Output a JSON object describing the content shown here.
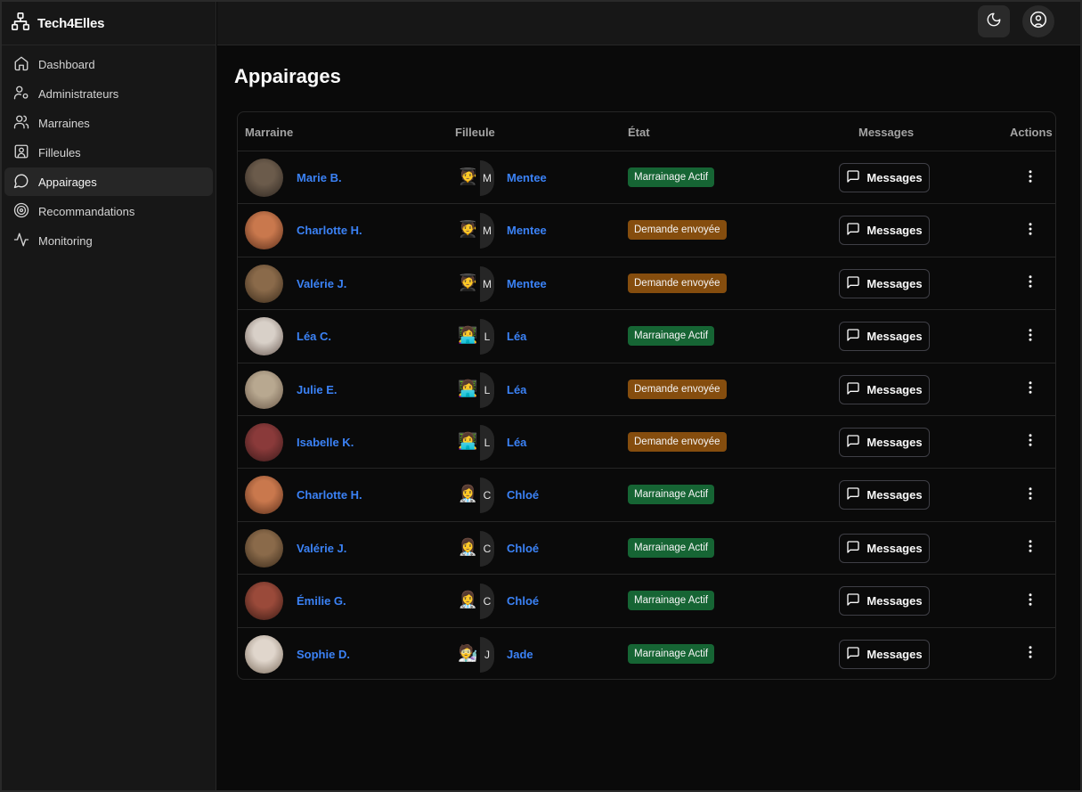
{
  "app": {
    "name": "Tech4Elles"
  },
  "sidebar": {
    "items": [
      {
        "label": "Dashboard",
        "icon": "home-icon"
      },
      {
        "label": "Administrateurs",
        "icon": "user-cog-icon"
      },
      {
        "label": "Marraines",
        "icon": "users-icon"
      },
      {
        "label": "Filleules",
        "icon": "contact-icon"
      },
      {
        "label": "Appairages",
        "icon": "message-circle-icon",
        "active": true
      },
      {
        "label": "Recommandations",
        "icon": "target-icon"
      },
      {
        "label": "Monitoring",
        "icon": "activity-icon"
      }
    ]
  },
  "page": {
    "title": "Appairages"
  },
  "table": {
    "headers": {
      "marraine": "Marraine",
      "filleule": "Filleule",
      "etat": "État",
      "messages": "Messages",
      "actions": "Actions"
    },
    "message_button_label": "Messages",
    "rows": [
      {
        "marraine": "Marie B.",
        "filleule_emoji": "🧑‍🎓",
        "filleule_initial": "M",
        "filleule": "Mentee",
        "etat": "Marrainage Actif",
        "etat_kind": "green"
      },
      {
        "marraine": "Charlotte H.",
        "filleule_emoji": "🧑‍🎓",
        "filleule_initial": "M",
        "filleule": "Mentee",
        "etat": "Demande envoyée",
        "etat_kind": "orange"
      },
      {
        "marraine": "Valérie J.",
        "filleule_emoji": "🧑‍🎓",
        "filleule_initial": "M",
        "filleule": "Mentee",
        "etat": "Demande envoyée",
        "etat_kind": "orange"
      },
      {
        "marraine": "Léa C.",
        "filleule_emoji": "👩‍💻",
        "filleule_initial": "L",
        "filleule": "Léa",
        "etat": "Marrainage Actif",
        "etat_kind": "green"
      },
      {
        "marraine": "Julie E.",
        "filleule_emoji": "👩‍💻",
        "filleule_initial": "L",
        "filleule": "Léa",
        "etat": "Demande envoyée",
        "etat_kind": "orange"
      },
      {
        "marraine": "Isabelle K.",
        "filleule_emoji": "👩‍💻",
        "filleule_initial": "L",
        "filleule": "Léa",
        "etat": "Demande envoyée",
        "etat_kind": "orange"
      },
      {
        "marraine": "Charlotte H.",
        "filleule_emoji": "👩‍⚕️",
        "filleule_initial": "C",
        "filleule": "Chloé",
        "etat": "Marrainage Actif",
        "etat_kind": "green"
      },
      {
        "marraine": "Valérie J.",
        "filleule_emoji": "👩‍⚕️",
        "filleule_initial": "C",
        "filleule": "Chloé",
        "etat": "Marrainage Actif",
        "etat_kind": "green"
      },
      {
        "marraine": "Émilie G.",
        "filleule_emoji": "👩‍⚕️",
        "filleule_initial": "C",
        "filleule": "Chloé",
        "etat": "Marrainage Actif",
        "etat_kind": "green"
      },
      {
        "marraine": "Sophie D.",
        "filleule_emoji": "🧑‍🔬",
        "filleule_initial": "J",
        "filleule": "Jade",
        "etat": "Marrainage Actif",
        "etat_kind": "green"
      }
    ]
  },
  "colors": {
    "link": "#3b82f6",
    "status_green": "#166534",
    "status_orange": "#854d0e"
  }
}
